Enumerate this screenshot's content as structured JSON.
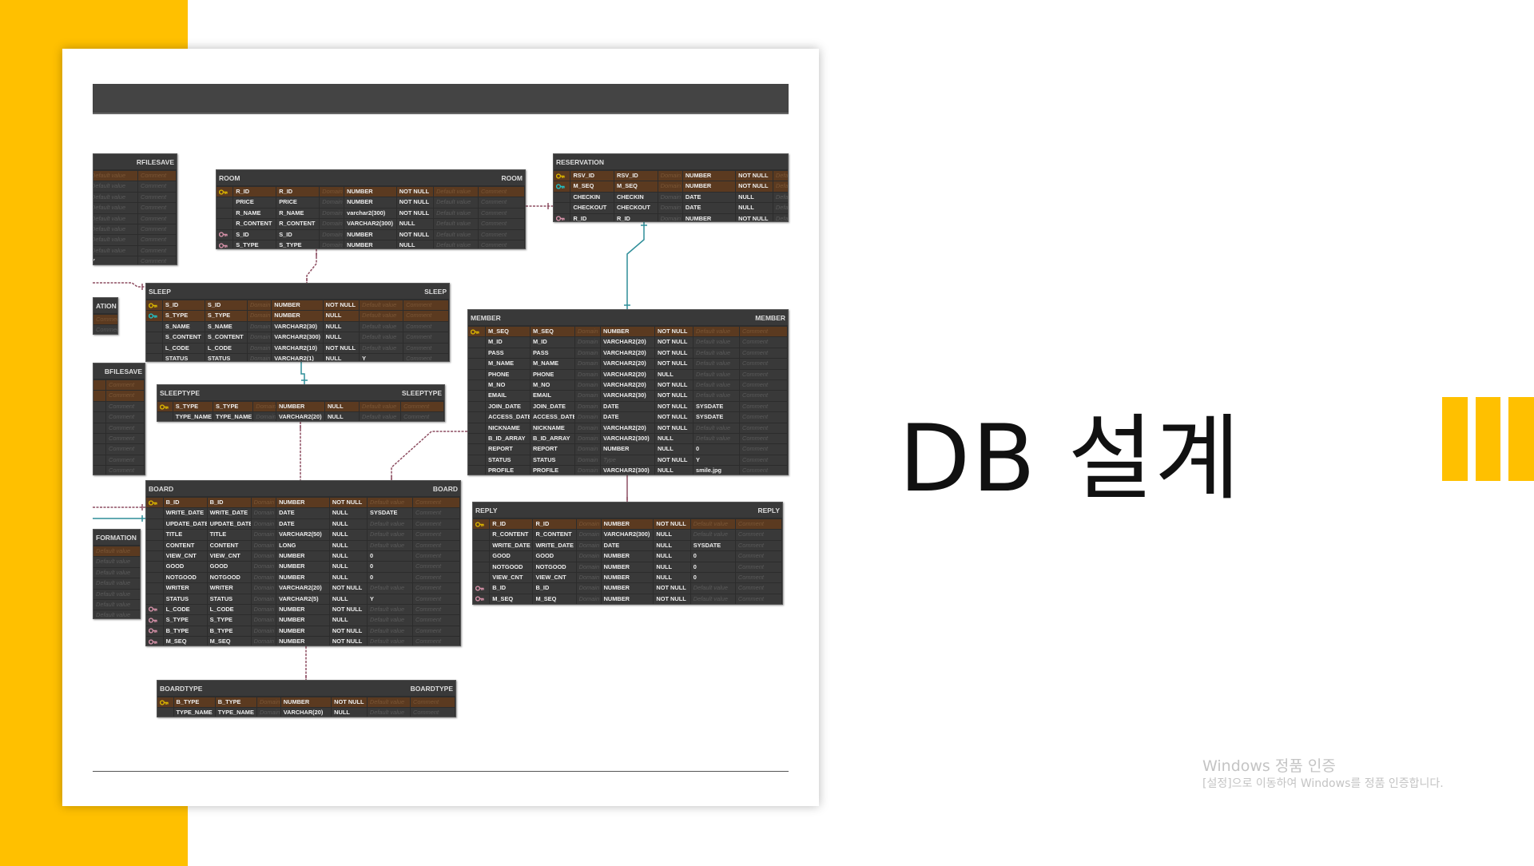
{
  "slide": {
    "title": "DB 설계",
    "accent_color": "#ffc000"
  },
  "watermark": {
    "line1": "Windows 정품 인증",
    "line2": "[설정]으로 이동하여 Windows를 정품 인증합니다."
  },
  "erd": {
    "colors": {
      "pk_key": "#d9b300",
      "pfk_key": "#22bfc4",
      "fk_key": "#d591a8",
      "identifying_line": "#2f8e99",
      "non_identifying_line": "#8e4f62",
      "table_bg": "#393939",
      "pk_row_bg": "#5b3a20"
    },
    "placeholders": {
      "domain": "Domain",
      "default": "Default value",
      "comment": "Comment",
      "type": "Type"
    },
    "tables": {
      "rfilesave": {
        "title_left": "",
        "title_right": "RFILESAVE",
        "cols": [
          "default",
          "comment"
        ],
        "rows": [
          {
            "pk": true,
            "default": null
          },
          {
            "default": null
          },
          {
            "default": null
          },
          {
            "default": null
          },
          {
            "default": null
          },
          {
            "default": null
          },
          {
            "default": null
          },
          {
            "default": null
          },
          {
            "default": "Y"
          }
        ]
      },
      "room": {
        "title_left": "ROOM",
        "title_right": "ROOM",
        "rows": [
          [
            "pk",
            "R_ID",
            "R_ID",
            "NUMBER",
            "NOT NULL",
            null
          ],
          [
            "",
            "PRICE",
            "PRICE",
            "NUMBER",
            "NOT NULL",
            null
          ],
          [
            "",
            "R_NAME",
            "R_NAME",
            "varchar2(300)",
            "NOT NULL",
            null
          ],
          [
            "",
            "R_CONTENT",
            "R_CONTENT",
            "VARCHAR2(300)",
            "NULL",
            null
          ],
          [
            "fk",
            "S_ID",
            "S_ID",
            "NUMBER",
            "NOT NULL",
            null
          ],
          [
            "fk",
            "S_TYPE",
            "S_TYPE",
            "NUMBER",
            "NULL",
            null
          ]
        ]
      },
      "reservation": {
        "title_left": "RESERVATION",
        "title_right": "R",
        "rows": [
          [
            "pk",
            "RSV_ID",
            "RSV_ID",
            "NUMBER",
            "NOT NULL",
            null
          ],
          [
            "pfk",
            "M_SEQ",
            "M_SEQ",
            "NUMBER",
            "NOT NULL",
            null
          ],
          [
            "",
            "CHECKIN",
            "CHECKIN",
            "DATE",
            "NULL",
            null
          ],
          [
            "",
            "CHECKOUT",
            "CHECKOUT",
            "DATE",
            "NULL",
            null
          ],
          [
            "fk",
            "R_ID",
            "R_ID",
            "NUMBER",
            "NOT NULL",
            null
          ]
        ]
      },
      "sleep": {
        "title_left": "SLEEP",
        "title_right": "SLEEP",
        "rows": [
          [
            "pk",
            "S_ID",
            "S_ID",
            "NUMBER",
            "NOT NULL",
            null
          ],
          [
            "pfk",
            "S_TYPE",
            "S_TYPE",
            "NUMBER",
            "NULL",
            null
          ],
          [
            "",
            "S_NAME",
            "S_NAME",
            "VARCHAR2(30)",
            "NULL",
            null
          ],
          [
            "",
            "S_CONTENT",
            "S_CONTENT",
            "VARCHAR2(300)",
            "NULL",
            null
          ],
          [
            "",
            "L_CODE",
            "L_CODE",
            "VARCHAR2(10)",
            "NOT NULL",
            null
          ],
          [
            "",
            "STATUS",
            "STATUS",
            "VARCHAR2(1)",
            "NULL",
            "Y"
          ]
        ]
      },
      "ation": {
        "title_left": "ATION",
        "title_right": "",
        "cols": [
          "comment"
        ],
        "rows": [
          {
            "pk": true
          },
          {}
        ]
      },
      "bfilesave": {
        "title_left": "",
        "title_right": "BFILESAVE",
        "cols": [
          "default",
          "comment"
        ],
        "rows": [
          {
            "pk": true,
            "default": null
          },
          {
            "pk": true,
            "default": null
          },
          {
            "default": null
          },
          {
            "default": null
          },
          {
            "default": null
          },
          {
            "default": null
          },
          {
            "default": null
          },
          {
            "default": ""
          },
          {
            "default": null
          }
        ]
      },
      "sleeptype": {
        "title_left": "SLEEPTYPE",
        "title_right": "SLEEPTYPE",
        "rows": [
          [
            "pk",
            "S_TYPE",
            "S_TYPE",
            "NUMBER",
            "NULL",
            null
          ],
          [
            "",
            "TYPE_NAME",
            "TYPE_NAME",
            "VARCHAR2(20)",
            "NULL",
            null
          ]
        ]
      },
      "member": {
        "title_left": "MEMBER",
        "title_right": "MEMBER",
        "rows": [
          [
            "pk",
            "M_SEQ",
            "M_SEQ",
            "NUMBER",
            "NOT NULL",
            null
          ],
          [
            "",
            "M_ID",
            "M_ID",
            "VARCHAR2(20)",
            "NOT NULL",
            null
          ],
          [
            "",
            "PASS",
            "PASS",
            "VARCHAR2(20)",
            "NOT NULL",
            null
          ],
          [
            "",
            "M_NAME",
            "M_NAME",
            "VARCHAR2(20)",
            "NOT NULL",
            null
          ],
          [
            "",
            "PHONE",
            "PHONE",
            "VARCHAR2(20)",
            "NULL",
            null
          ],
          [
            "",
            "M_NO",
            "M_NO",
            "VARCHAR2(20)",
            "NOT NULL",
            null
          ],
          [
            "",
            "EMAIL",
            "EMAIL",
            "VARCHAR2(30)",
            "NOT NULL",
            null
          ],
          [
            "",
            "JOIN_DATE",
            "JOIN_DATE",
            "DATE",
            "NOT NULL",
            "SYSDATE"
          ],
          [
            "",
            "ACCESS_DATE",
            "ACCESS_DATE",
            "DATE",
            "NOT NULL",
            "SYSDATE"
          ],
          [
            "",
            "NICKNAME",
            "NICKNAME",
            "VARCHAR2(20)",
            "NOT NULL",
            null
          ],
          [
            "",
            "B_ID_ARRAY",
            "B_ID_ARRAY",
            "VARCHAR2(300)",
            "NULL",
            null
          ],
          [
            "",
            "REPORT",
            "REPORT",
            "NUMBER",
            "NULL",
            "0"
          ],
          [
            "",
            "STATUS",
            "STATUS",
            null,
            "NOT NULL",
            "Y"
          ],
          [
            "",
            "PROFILE",
            "PROFILE",
            "VARCHAR2(300)",
            "NULL",
            "smile.jpg"
          ]
        ]
      },
      "board": {
        "title_left": "BOARD",
        "title_right": "BOARD",
        "rows": [
          [
            "pk",
            "B_ID",
            "B_ID",
            "NUMBER",
            "NOT NULL",
            null
          ],
          [
            "",
            "WRITE_DATE",
            "WRITE_DATE",
            "DATE",
            "NULL",
            "SYSDATE"
          ],
          [
            "",
            "UPDATE_DATE",
            "UPDATE_DATE",
            "DATE",
            "NULL",
            null
          ],
          [
            "",
            "TITLE",
            "TITLE",
            "VARCHAR2(50)",
            "NULL",
            null
          ],
          [
            "",
            "CONTENT",
            "CONTENT",
            "LONG",
            "NULL",
            null
          ],
          [
            "",
            "VIEW_CNT",
            "VIEW_CNT",
            "NUMBER",
            "NULL",
            "0"
          ],
          [
            "",
            "GOOD",
            "GOOD",
            "NUMBER",
            "NULL",
            "0"
          ],
          [
            "",
            "NOTGOOD",
            "NOTGOOD",
            "NUMBER",
            "NULL",
            "0"
          ],
          [
            "",
            "WRITER",
            "WRITER",
            "VARCHAR2(20)",
            "NOT NULL",
            null
          ],
          [
            "",
            "STATUS",
            "STATUS",
            "VARCHAR2(5)",
            "NULL",
            "Y"
          ],
          [
            "fk",
            "L_CODE",
            "L_CODE",
            "NUMBER",
            "NOT NULL",
            null
          ],
          [
            "fk",
            "S_TYPE",
            "S_TYPE",
            "NUMBER",
            "NULL",
            null
          ],
          [
            "fk",
            "B_TYPE",
            "B_TYPE",
            "NUMBER",
            "NOT NULL",
            null
          ],
          [
            "fk",
            "M_SEQ",
            "M_SEQ",
            "NUMBER",
            "NOT NULL",
            null
          ]
        ]
      },
      "formation": {
        "title_left": "FORMATION",
        "title_right": "",
        "cols": [
          "default",
          "comment"
        ],
        "rows": [
          {
            "pk": true,
            "default": null
          },
          {
            "default": null
          },
          {
            "default": null
          },
          {
            "default": null
          },
          {
            "default": null
          },
          {
            "default": null
          },
          {
            "default": null
          }
        ]
      },
      "reply": {
        "title_left": "REPLY",
        "title_right": "REPLY",
        "rows": [
          [
            "pk",
            "R_ID",
            "R_ID",
            "NUMBER",
            "NOT NULL",
            null
          ],
          [
            "",
            "R_CONTENT",
            "R_CONTENT",
            "VARCHAR2(300)",
            "NULL",
            null
          ],
          [
            "",
            "WRITE_DATE",
            "WRITE_DATE",
            "DATE",
            "NULL",
            "SYSDATE"
          ],
          [
            "",
            "GOOD",
            "GOOD",
            "NUMBER",
            "NULL",
            "0"
          ],
          [
            "",
            "NOTGOOD",
            "NOTGOOD",
            "NUMBER",
            "NULL",
            "0"
          ],
          [
            "",
            "VIEW_CNT",
            "VIEW_CNT",
            "NUMBER",
            "NULL",
            "0"
          ],
          [
            "fk",
            "B_ID",
            "B_ID",
            "NUMBER",
            "NOT NULL",
            null
          ],
          [
            "fk",
            "M_SEQ",
            "M_SEQ",
            "NUMBER",
            "NOT NULL",
            null
          ]
        ]
      },
      "boardtype": {
        "title_left": "BOARDTYPE",
        "title_right": "BOARDTYPE",
        "rows": [
          [
            "pk",
            "B_TYPE",
            "B_TYPE",
            "NUMBER",
            "NOT NULL",
            null
          ],
          [
            "",
            "TYPE_NAME",
            "TYPE_NAME",
            "VARCHAR(20)",
            "NULL",
            null
          ]
        ]
      }
    }
  }
}
